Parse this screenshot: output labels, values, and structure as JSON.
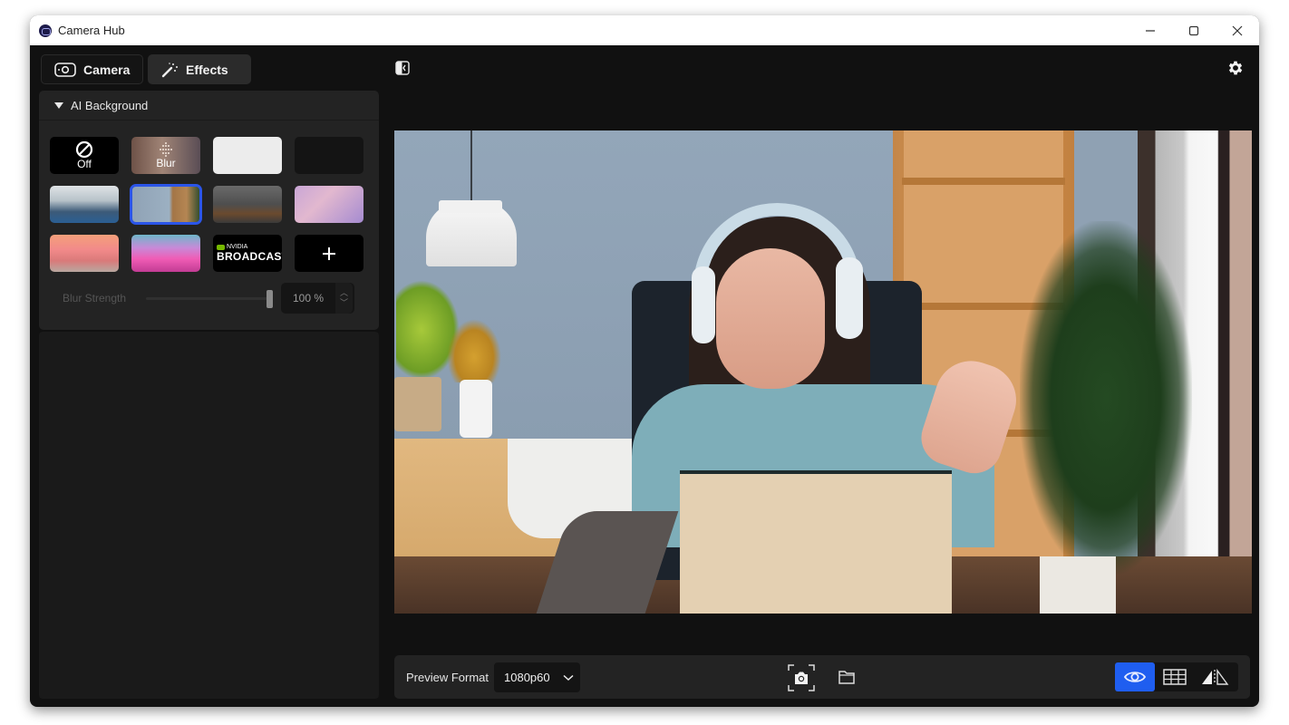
{
  "window": {
    "title": "Camera Hub",
    "controls": [
      "minimize",
      "maximize",
      "close"
    ]
  },
  "tabs": [
    {
      "label": "Camera",
      "icon": "camera-icon",
      "active": false
    },
    {
      "label": "Effects",
      "icon": "magic-wand-icon",
      "active": true
    }
  ],
  "ai_background": {
    "section_label": "AI Background",
    "expanded": true,
    "tiles": [
      {
        "id": "off",
        "label": "Off",
        "icon": "block-icon",
        "selected": false
      },
      {
        "id": "blur",
        "label": "Blur",
        "icon": "blur-dots-icon",
        "selected": false
      },
      {
        "id": "white-bg",
        "label": "",
        "selected": false
      },
      {
        "id": "dark-bg",
        "label": "",
        "selected": false
      },
      {
        "id": "office",
        "label": "",
        "selected": false
      },
      {
        "id": "room",
        "label": "",
        "selected": true
      },
      {
        "id": "studio",
        "label": "",
        "selected": false
      },
      {
        "id": "anime-room",
        "label": "",
        "selected": false
      },
      {
        "id": "pink-lounge",
        "label": "",
        "selected": false
      },
      {
        "id": "neon-sofa",
        "label": "",
        "selected": false
      },
      {
        "id": "nvidia-broadcast",
        "label": "BROADCAST",
        "brand": "NVIDIA",
        "selected": false
      },
      {
        "id": "add",
        "label": "+",
        "selected": false
      }
    ],
    "selected_color": "#2b55e8",
    "blur_strength": {
      "label": "Blur Strength",
      "value_text": "100 %",
      "value_percent": 100,
      "up_glyph": "︿",
      "down_glyph": "﹀"
    }
  },
  "toolbar": {
    "preview_format_label": "Preview Format",
    "preview_format_value": "1080p60",
    "active_view": "preview",
    "active_color": "#1f5ef0"
  }
}
